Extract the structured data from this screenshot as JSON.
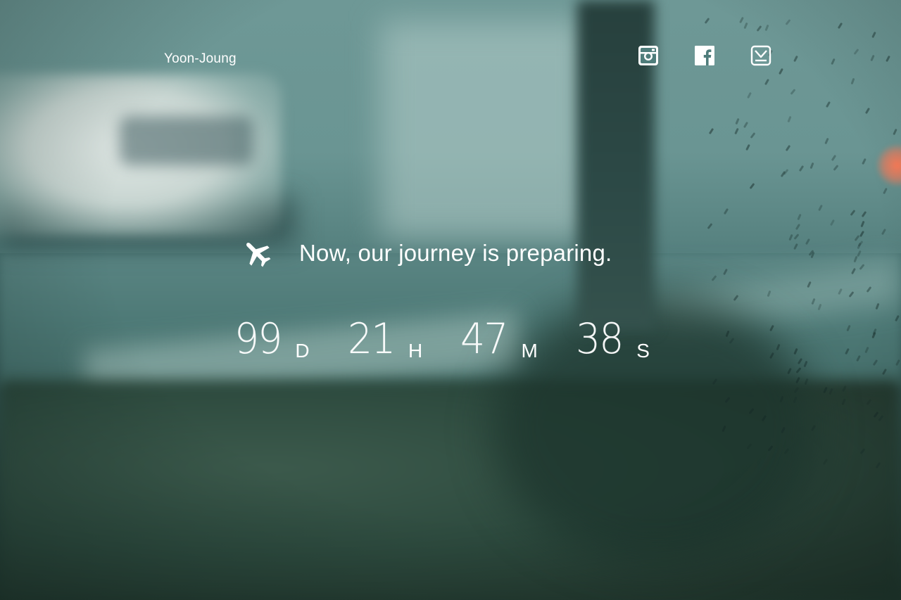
{
  "header": {
    "brand": "Yoon-Joung",
    "social": [
      {
        "name": "instagram-icon"
      },
      {
        "name": "facebook-icon"
      },
      {
        "name": "mail-icon"
      }
    ]
  },
  "hero": {
    "icon": "airplane-icon",
    "tagline": "Now, our journey is preparing."
  },
  "countdown": {
    "days": "99",
    "days_label": "D",
    "hours": "21",
    "hours_label": "H",
    "minutes": "47",
    "minutes_label": "M",
    "seconds": "38",
    "seconds_label": "S"
  },
  "colors": {
    "text": "#ffffff",
    "background_tint": "#4d7a79"
  }
}
